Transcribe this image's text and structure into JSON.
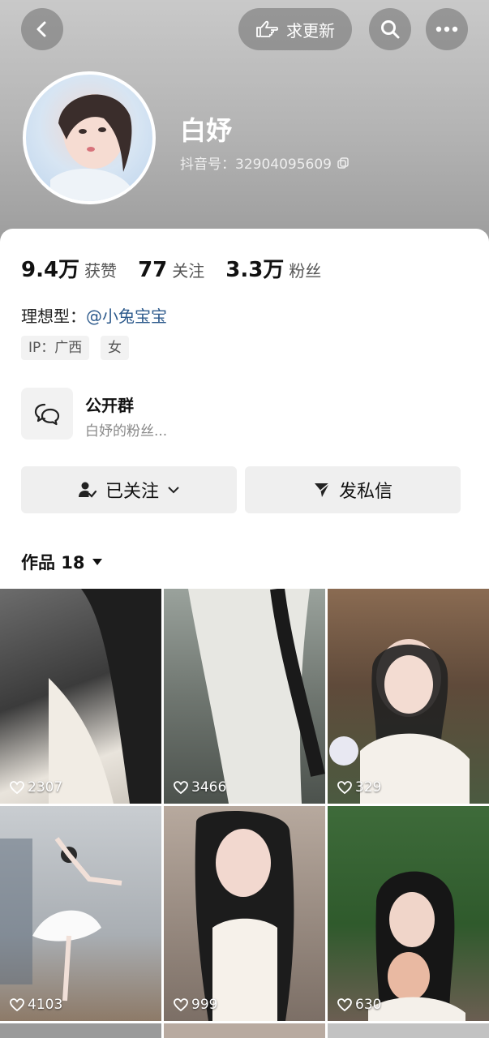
{
  "topbar": {
    "request_update_label": "求更新"
  },
  "profile": {
    "name": "白妤",
    "douyin_id": "抖音号：32904095609"
  },
  "stats": [
    {
      "value": "9.4万",
      "label": "获赞"
    },
    {
      "value": "77",
      "label": "关注"
    },
    {
      "value": "3.3万",
      "label": "粉丝"
    }
  ],
  "ideal_type": {
    "label": "理想型：",
    "mention": "@小兔宝宝"
  },
  "tags": [
    "IP：广西",
    "女"
  ],
  "group": {
    "title": "公开群",
    "subtitle": "白妤的粉丝..."
  },
  "actions": {
    "follow_label": "已关注",
    "message_label": "发私信"
  },
  "works": {
    "label": "作品 18"
  },
  "videos": [
    {
      "likes": "2307"
    },
    {
      "likes": "3466"
    },
    {
      "likes": "329"
    },
    {
      "likes": "4103"
    },
    {
      "likes": "999"
    },
    {
      "likes": "630"
    }
  ],
  "colors": {
    "mention": "#2d5a8c",
    "button_bg": "#efefef"
  }
}
